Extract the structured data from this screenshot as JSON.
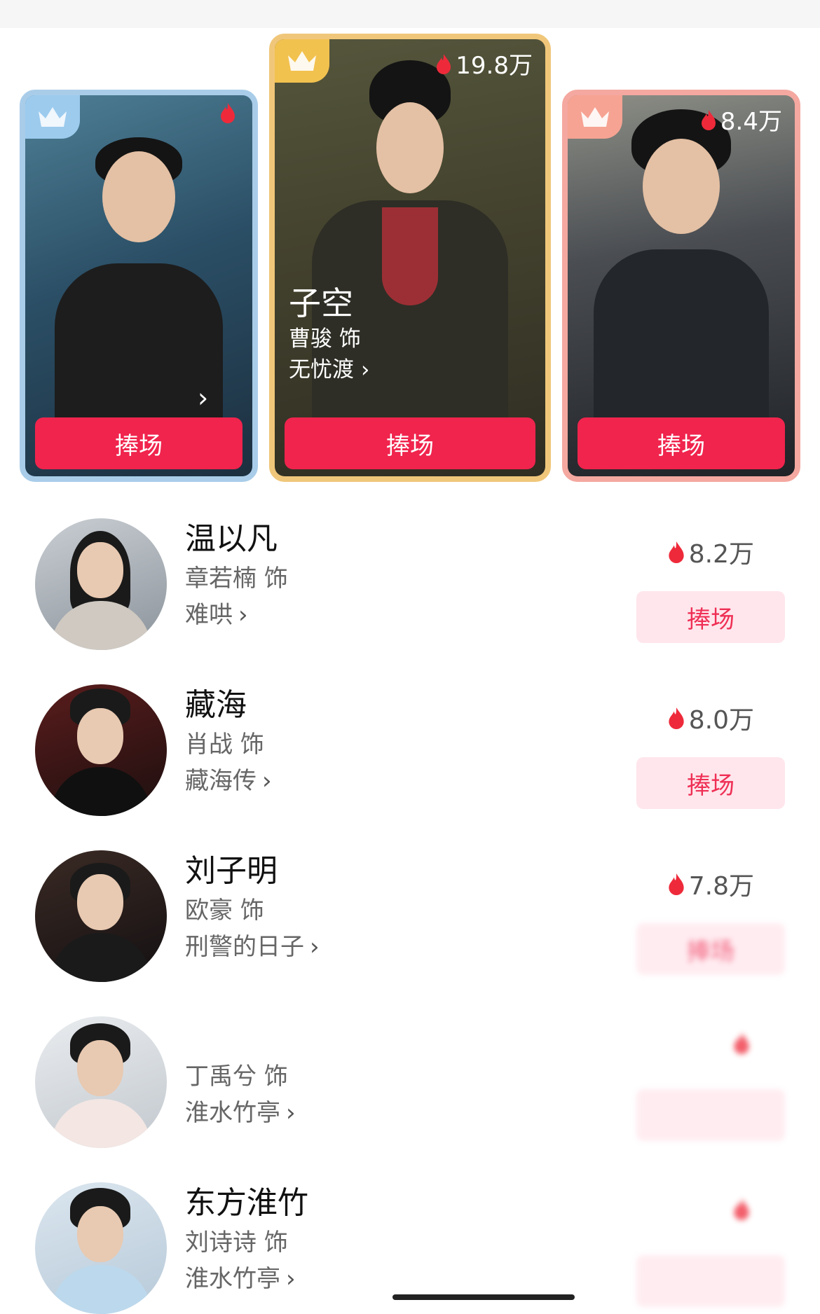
{
  "podium": [
    {
      "rank": 2,
      "role": "",
      "actor": "",
      "show": "",
      "heat": "",
      "button": "捧场",
      "crown": "crown-icon"
    },
    {
      "rank": 1,
      "role": "子空",
      "actor": "曹骏 饰",
      "show": "无忧渡",
      "heat": "19.8万",
      "button": "捧场",
      "crown": "crown-icon"
    },
    {
      "rank": 3,
      "role": "",
      "actor": "",
      "show": "",
      "heat": "8.4万",
      "button": "捧场",
      "crown": "crown-icon"
    }
  ],
  "list": [
    {
      "role": "温以凡",
      "actor": "章若楠 饰",
      "show": "难哄",
      "heat": "8.2万",
      "button": "捧场"
    },
    {
      "role": "藏海",
      "actor": "肖战 饰",
      "show": "藏海传",
      "heat": "8.0万",
      "button": "捧场"
    },
    {
      "role": "刘子明",
      "actor": "欧豪 饰",
      "show": "刑警的日子",
      "heat": "7.8万",
      "button": "捧场"
    },
    {
      "role": "",
      "actor": "丁禹兮 饰",
      "show": "淮水竹亭",
      "heat": "",
      "button": ""
    },
    {
      "role": "东方淮竹",
      "actor": "刘诗诗 饰",
      "show": "淮水竹亭",
      "heat": "",
      "button": ""
    }
  ],
  "glyphs": {
    "chevron": "›"
  },
  "colors": {
    "accent": "#f0244d",
    "accent_light": "#ffe6ec",
    "gold": "#f0c77a",
    "silver": "#a9cde9",
    "bronze": "#f4a8a0"
  }
}
